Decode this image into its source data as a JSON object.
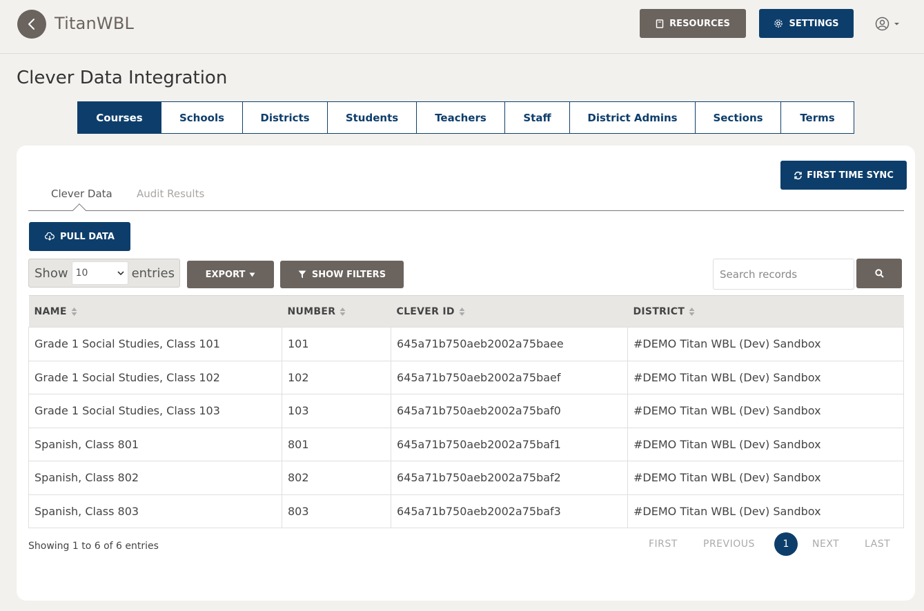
{
  "header": {
    "app_title": "TitanWBL",
    "resources_label": "RESOURCES",
    "settings_label": "SETTINGS"
  },
  "page": {
    "title": "Clever Data Integration"
  },
  "main_tabs": [
    {
      "label": "Courses",
      "active": true
    },
    {
      "label": "Schools"
    },
    {
      "label": "Districts"
    },
    {
      "label": "Students"
    },
    {
      "label": "Teachers"
    },
    {
      "label": "Staff"
    },
    {
      "label": "District Admins"
    },
    {
      "label": "Sections"
    },
    {
      "label": "Terms"
    }
  ],
  "card": {
    "sync_label": "FIRST TIME SYNC",
    "sub_tabs": [
      {
        "label": "Clever Data",
        "active": true
      },
      {
        "label": "Audit Results"
      }
    ],
    "pull_label": "PULL DATA",
    "length": {
      "show": "Show",
      "value": "10",
      "entries": "entries"
    },
    "export_label": "EXPORT",
    "filters_label": "SHOW FILTERS",
    "search_placeholder": "Search records"
  },
  "table": {
    "columns": [
      "NAME",
      "NUMBER",
      "CLEVER ID",
      "DISTRICT"
    ],
    "rows": [
      [
        "Grade 1 Social Studies, Class 101",
        "101",
        "645a71b750aeb2002a75baee",
        "#DEMO Titan WBL (Dev) Sandbox"
      ],
      [
        "Grade 1 Social Studies, Class 102",
        "102",
        "645a71b750aeb2002a75baef",
        "#DEMO Titan WBL (Dev) Sandbox"
      ],
      [
        "Grade 1 Social Studies, Class 103",
        "103",
        "645a71b750aeb2002a75baf0",
        "#DEMO Titan WBL (Dev) Sandbox"
      ],
      [
        "Spanish, Class 801",
        "801",
        "645a71b750aeb2002a75baf1",
        "#DEMO Titan WBL (Dev) Sandbox"
      ],
      [
        "Spanish, Class 802",
        "802",
        "645a71b750aeb2002a75baf2",
        "#DEMO Titan WBL (Dev) Sandbox"
      ],
      [
        "Spanish, Class 803",
        "803",
        "645a71b750aeb2002a75baf3",
        "#DEMO Titan WBL (Dev) Sandbox"
      ]
    ]
  },
  "footer": {
    "info": "Showing 1 to 6 of 6 entries",
    "first": "FIRST",
    "previous": "PREVIOUS",
    "current_page": "1",
    "next": "NEXT",
    "last": "LAST"
  },
  "colors": {
    "primary": "#0d3e6b",
    "secondary": "#6b635d",
    "background": "#f2f1ee"
  }
}
